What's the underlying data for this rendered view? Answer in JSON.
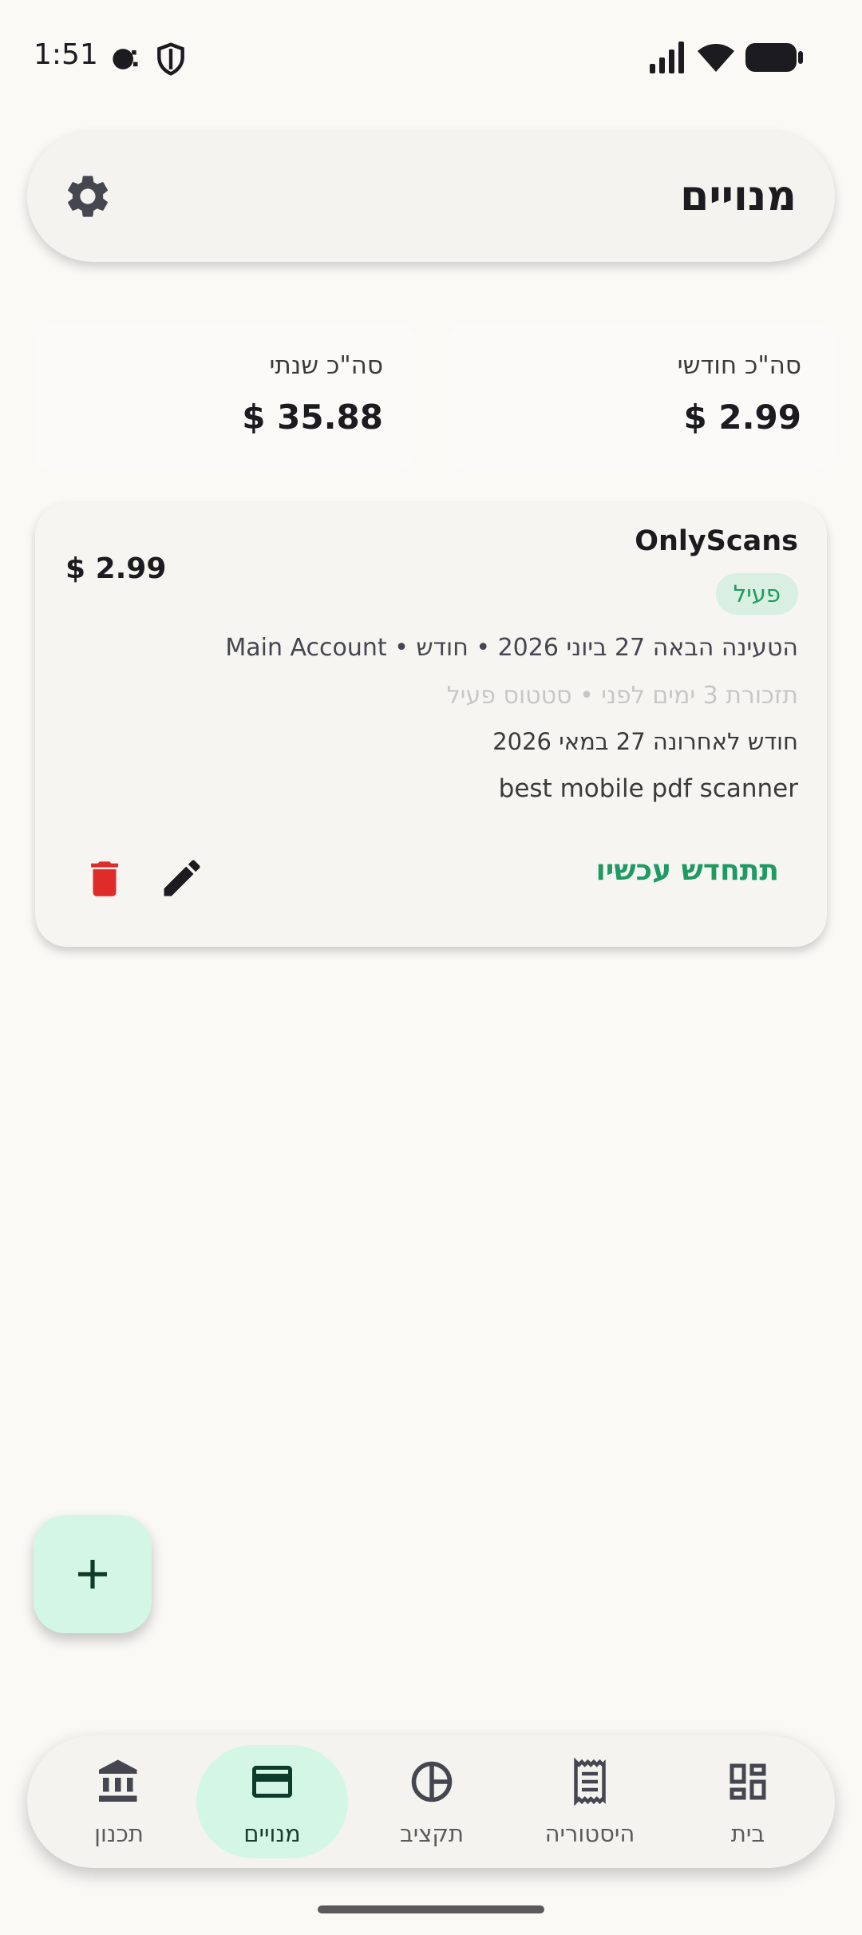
{
  "status_bar": {
    "time": "1:51"
  },
  "header": {
    "title": "מנויים"
  },
  "totals": {
    "monthly_label": "סה\"כ חודשי",
    "monthly_value": "$ 2.99",
    "yearly_label": "סה\"כ שנתי",
    "yearly_value": "$ 35.88"
  },
  "subscription": {
    "name": "OnlyScans",
    "price": "$ 2.99",
    "status": "פעיל",
    "next_charge": "הטעינה הבאה 27 ביוני 2026 • חודש • Main Account",
    "reminder": "תזכורת 3 ימים לפני • סטטוס פעיל",
    "last": "חודש לאחרונה 27 במאי 2026",
    "note": "best mobile pdf scanner",
    "renew_label": "תתחדש עכשיו"
  },
  "fab": {
    "label": "+"
  },
  "nav": {
    "items": [
      {
        "label": "תכנון",
        "icon": "bank-icon"
      },
      {
        "label": "מנויים",
        "icon": "credit-card-icon"
      },
      {
        "label": "תקציב",
        "icon": "pie-chart-icon"
      },
      {
        "label": "היסטוריה",
        "icon": "receipt-icon"
      },
      {
        "label": "בית",
        "icon": "dashboard-icon"
      }
    ]
  },
  "colors": {
    "accent": "#1f9a62",
    "accent_bg": "#d4f7e5",
    "delete": "#e02b2b",
    "background": "#faf9f6"
  }
}
